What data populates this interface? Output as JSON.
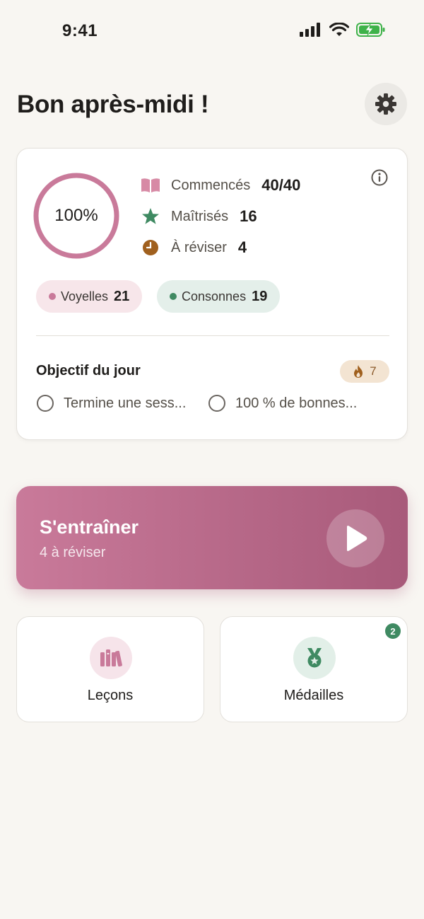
{
  "status_bar": {
    "time": "9:41"
  },
  "header": {
    "title": "Bon après-midi !"
  },
  "progress": {
    "percent_label": "100%",
    "percent_value": 100,
    "stats": [
      {
        "icon": "book-open-icon",
        "label": "Commencés",
        "value": "40/40"
      },
      {
        "icon": "star-icon",
        "label": "Maîtrisés",
        "value": "16"
      },
      {
        "icon": "clock-icon",
        "label": "À réviser",
        "value": "4"
      }
    ],
    "pills": [
      {
        "label": "Voyelles",
        "count": "21"
      },
      {
        "label": "Consonnes",
        "count": "19"
      }
    ]
  },
  "daily_goal": {
    "title": "Objectif du jour",
    "streak": "7",
    "items": [
      {
        "label": "Termine une sess..."
      },
      {
        "label": "100 % de bonnes..."
      }
    ]
  },
  "train": {
    "title": "S'entraîner",
    "subtitle": "4 à réviser"
  },
  "tiles": {
    "lessons": {
      "label": "Leçons"
    },
    "medals": {
      "label": "Médailles",
      "badge": "2"
    }
  },
  "colors": {
    "accent_pink": "#c97a9a",
    "accent_pink_dark": "#a85a7a",
    "green": "#3f8a62",
    "amber": "#a0601e",
    "background": "#f8f6f2"
  }
}
